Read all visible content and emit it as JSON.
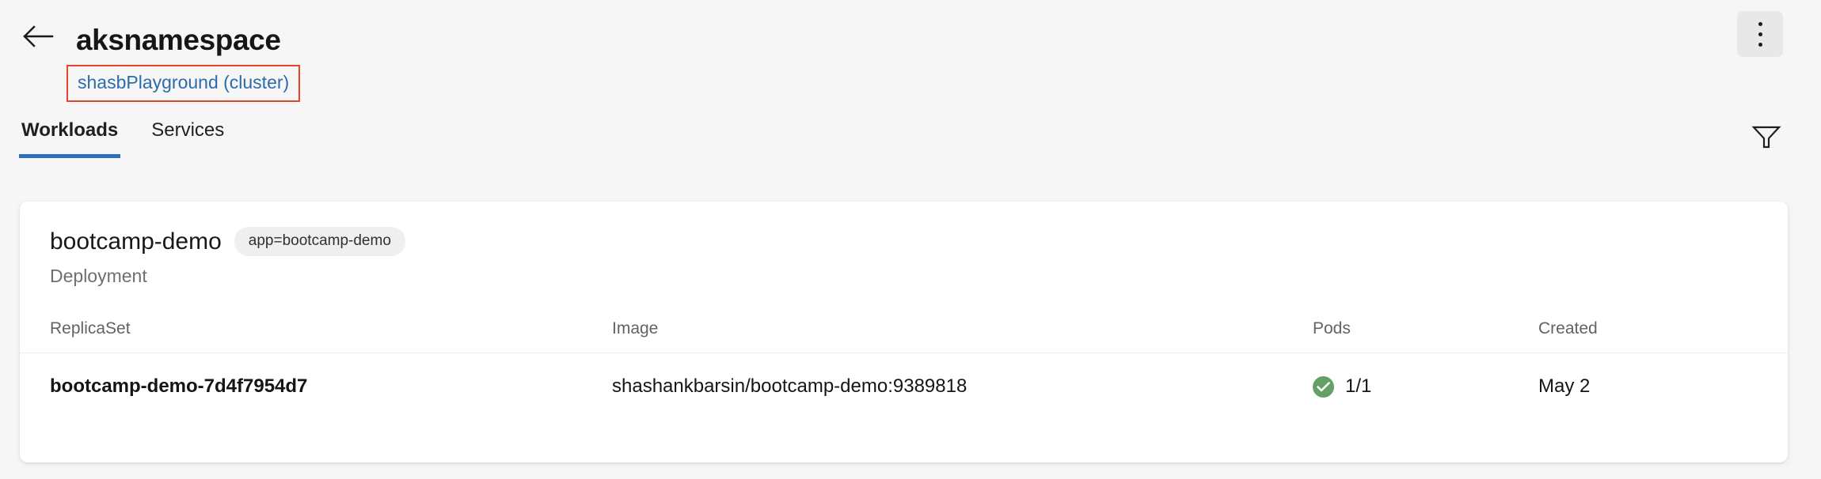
{
  "header": {
    "back_icon": "arrow-left-icon",
    "title": "aksnamespace",
    "cluster_link": "shasbPlayground (cluster)",
    "annotation_box_color": "#e8452c",
    "link_color": "#2c6ca8",
    "more_menu_icon": "kebab-menu-icon",
    "filter_icon": "filter-funnel-icon"
  },
  "tabs": [
    {
      "label": "Workloads",
      "active": true
    },
    {
      "label": "Services",
      "active": false
    }
  ],
  "accent_color": "#2f6fba",
  "workload_card": {
    "title": "bootcamp-demo",
    "label_pill": "app=bootcamp-demo",
    "kind": "Deployment",
    "table": {
      "columns": [
        "ReplicaSet",
        "Image",
        "Pods",
        "Created"
      ],
      "rows": [
        {
          "replicaset": "bootcamp-demo-7d4f7954d7",
          "image": "shashankbarsin/bootcamp-demo:9389818",
          "pods": "1/1",
          "pods_status": "healthy",
          "pods_status_color": "#64a064",
          "created": "May 2"
        }
      ]
    }
  }
}
